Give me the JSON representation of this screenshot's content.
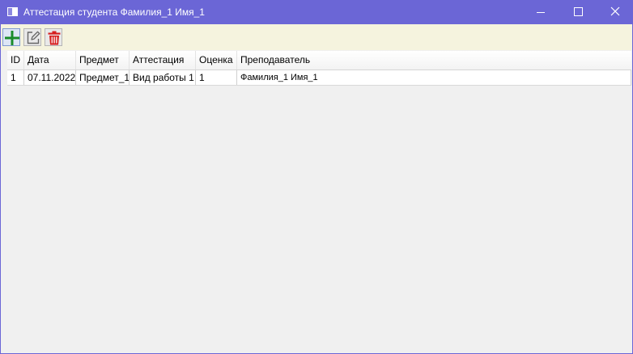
{
  "window": {
    "title": "Аттестация студента Фамилия_1 Имя_1",
    "accent_color": "#6b66d6"
  },
  "title_buttons": {
    "minimize_icon": "minimize-icon",
    "maximize_icon": "maximize-icon",
    "close_icon": "close-icon"
  },
  "toolbar": {
    "add_icon": "plus-icon",
    "edit_icon": "edit-icon",
    "delete_icon": "trash-icon",
    "background": "#f5f3de"
  },
  "grid": {
    "columns": [
      "ID",
      "Дата",
      "Предмет",
      "Аттестация",
      "Оценка",
      "Преподаватель"
    ],
    "rows": [
      [
        "1",
        "07.11.2022",
        "Предмет_1",
        "Вид работы 1",
        "1",
        "Фамилия_1 Имя_1"
      ]
    ]
  }
}
